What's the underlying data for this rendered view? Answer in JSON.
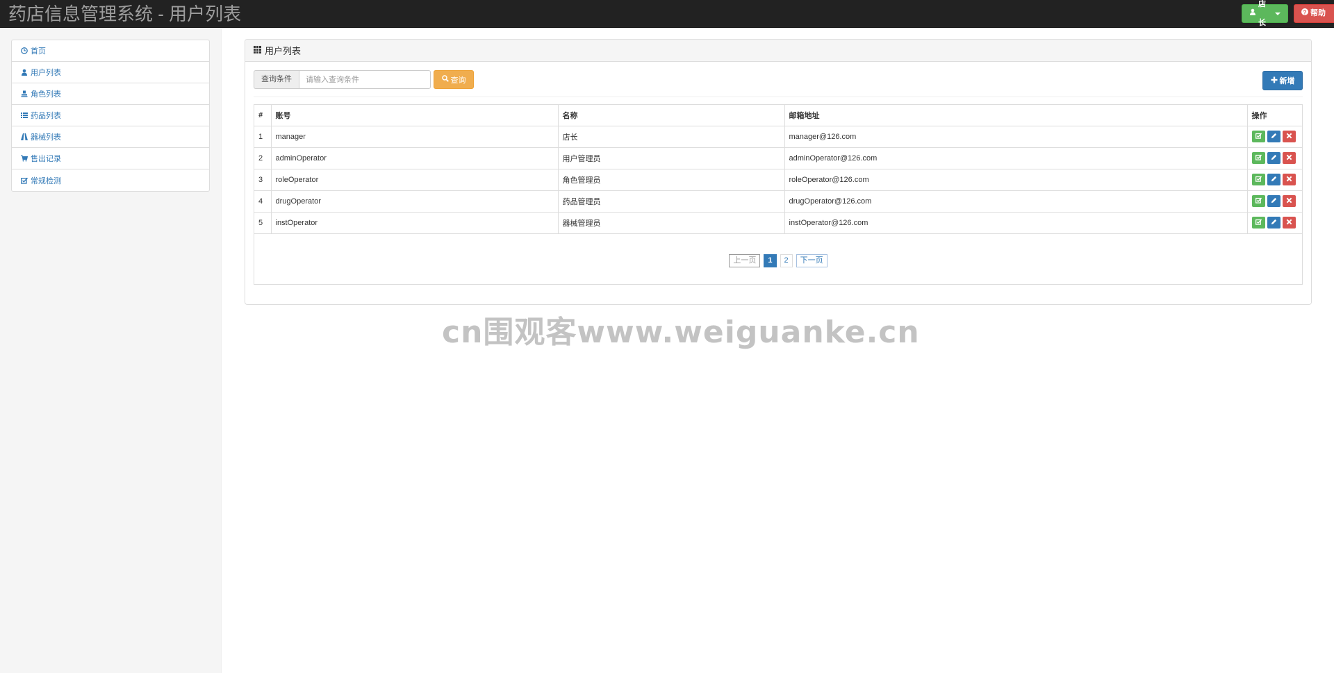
{
  "header": {
    "title": "药店信息管理系统 - 用户列表",
    "user_button": "店长",
    "help_button": "帮助"
  },
  "sidebar": {
    "items": [
      {
        "label": "首页",
        "icon": "clock-icon"
      },
      {
        "label": "用户列表",
        "icon": "user-icon"
      },
      {
        "label": "角色列表",
        "icon": "role-icon"
      },
      {
        "label": "药品列表",
        "icon": "list-icon"
      },
      {
        "label": "器械列表",
        "icon": "road-icon"
      },
      {
        "label": "售出记录",
        "icon": "cart-icon"
      },
      {
        "label": "常规检测",
        "icon": "check-icon"
      }
    ]
  },
  "panel": {
    "title": "用户列表",
    "search_label": "查询条件",
    "search_placeholder": "请输入查询条件",
    "search_button": "查询",
    "add_button": "新增"
  },
  "table": {
    "columns": [
      "#",
      "账号",
      "名称",
      "邮箱地址",
      "操作"
    ],
    "rows": [
      [
        "1",
        "manager",
        "店长",
        "manager@126.com"
      ],
      [
        "2",
        "adminOperator",
        "用户管理员",
        "adminOperator@126.com"
      ],
      [
        "3",
        "roleOperator",
        "角色管理员",
        "roleOperator@126.com"
      ],
      [
        "4",
        "drugOperator",
        "药品管理员",
        "drugOperator@126.com"
      ],
      [
        "5",
        "instOperator",
        "器械管理员",
        "instOperator@126.com"
      ]
    ]
  },
  "pagination": {
    "prev": "上一页",
    "pages": [
      "1",
      "2"
    ],
    "current": "1",
    "next": "下一页"
  },
  "watermark": "cn围观客www.weiguanke.cn",
  "colors": {
    "topbar": "#222222",
    "success": "#5cb85c",
    "danger": "#d9534f",
    "primary": "#337ab7",
    "warning": "#f0ad4e"
  }
}
